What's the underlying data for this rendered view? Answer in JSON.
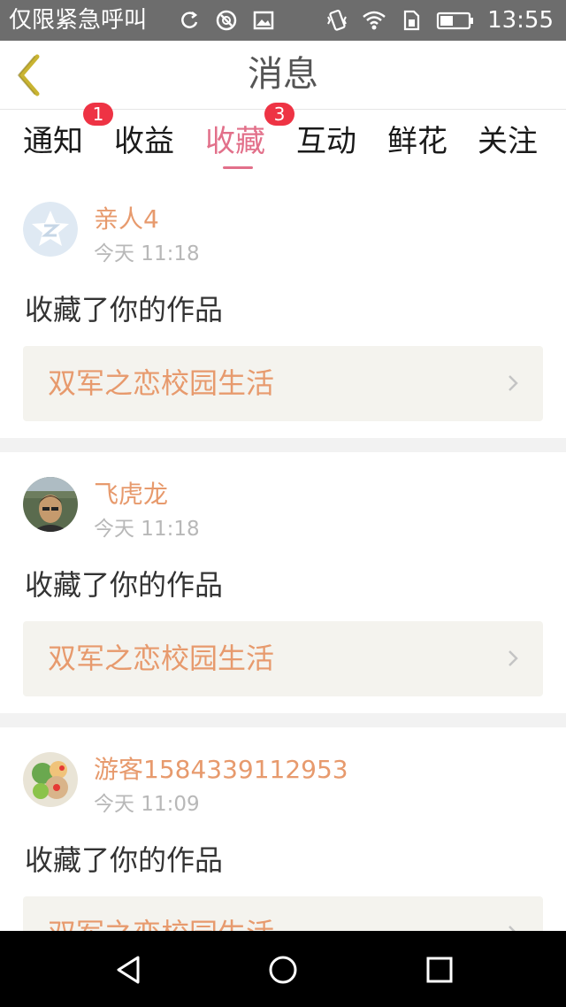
{
  "status_bar": {
    "left_text": "仅限紧急呼叫",
    "time": "13:55",
    "icons": [
      "sync-icon",
      "blocked-icon",
      "image-icon",
      "vibrate-icon",
      "wifi-icon",
      "sim-icon",
      "battery-icon"
    ]
  },
  "header": {
    "title": "消息",
    "back_icon": "back-chevron-icon"
  },
  "tabs": [
    {
      "label": "通知",
      "badge": "1"
    },
    {
      "label": "收益",
      "badge": ""
    },
    {
      "label": "收藏",
      "badge": "3",
      "active": true
    },
    {
      "label": "互动",
      "badge": ""
    },
    {
      "label": "鲜花",
      "badge": ""
    },
    {
      "label": "关注",
      "badge": ""
    }
  ],
  "feed": [
    {
      "username": "亲人4",
      "time": "今天 11:18",
      "action": "收藏了你的作品",
      "work_title": "双军之恋校园生活",
      "avatar": "default-avatar"
    },
    {
      "username": "飞虎龙",
      "time": "今天 11:18",
      "action": "收藏了你的作品",
      "work_title": "双军之恋校园生活",
      "avatar": "photo-avatar"
    },
    {
      "username": "游客1584339112953",
      "time": "今天 11:09",
      "action": "收藏了你的作品",
      "work_title": "双军之恋校园生活",
      "avatar": "food-avatar"
    }
  ],
  "colors": {
    "accent_pink": "#e2708a",
    "name_orange": "#e79a6d",
    "badge_red": "#ee3344",
    "work_box_bg": "#f4f3ee"
  },
  "nav_bar": {
    "icons": [
      "back-triangle-icon",
      "home-circle-icon",
      "recents-square-icon"
    ]
  }
}
